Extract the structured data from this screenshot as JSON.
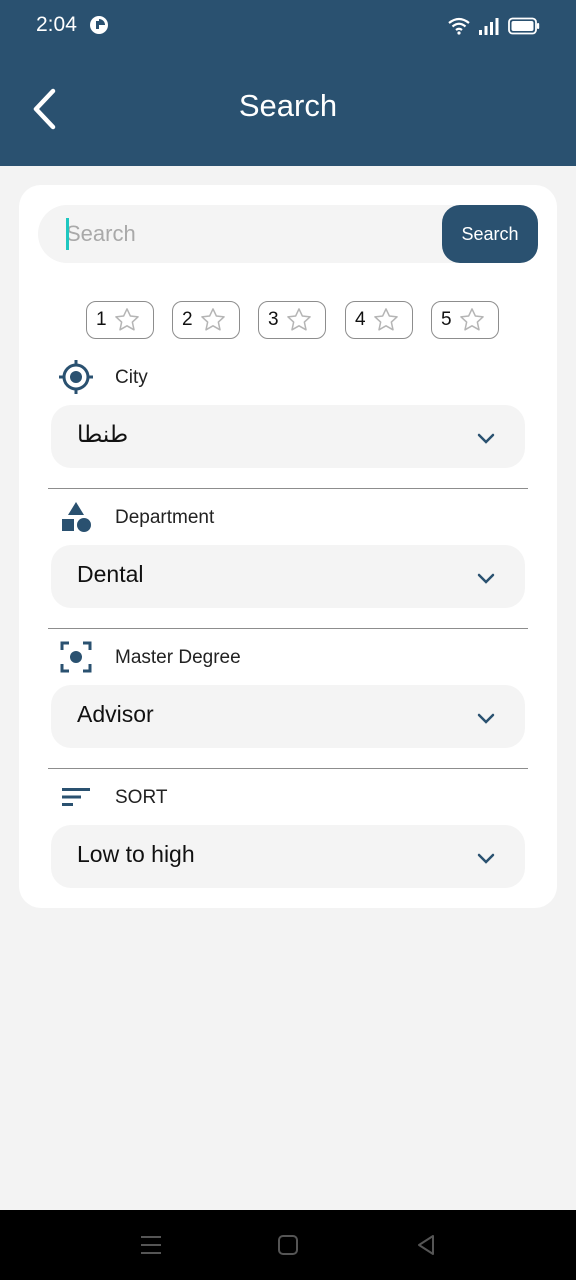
{
  "status_bar": {
    "time": "2:04"
  },
  "header": {
    "title": "Search"
  },
  "search": {
    "placeholder": "Search",
    "value": "",
    "button_label": "Search"
  },
  "ratings": [
    {
      "number": "1"
    },
    {
      "number": "2"
    },
    {
      "number": "3"
    },
    {
      "number": "4"
    },
    {
      "number": "5"
    }
  ],
  "filters": {
    "city": {
      "label": "City",
      "value": "طنطا",
      "icon": "location-target-icon"
    },
    "department": {
      "label": "Department",
      "value": "Dental",
      "icon": "shapes-icon"
    },
    "degree": {
      "label": "Master Degree",
      "value": "Advisor",
      "icon": "focus-icon"
    },
    "sort": {
      "label": "SORT",
      "value": "Low to high",
      "icon": "sort-icon"
    }
  },
  "colors": {
    "primary": "#2a5170",
    "background": "#f3f3f3",
    "field": "#f4f4f4",
    "caret": "#1ec7c0"
  }
}
